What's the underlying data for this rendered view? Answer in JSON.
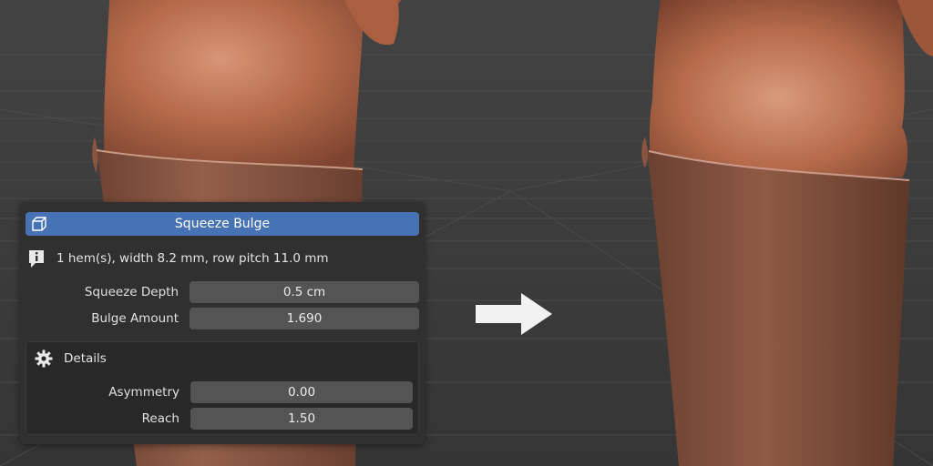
{
  "panel": {
    "title": "Squeeze Bulge",
    "header_icon": "cube-icon",
    "info_icon": "info-icon",
    "info_text": "1 hem(s), width 8.2 mm, row pitch 11.0 mm",
    "properties": [
      {
        "label": "Squeeze Depth",
        "value": "0.5 cm"
      },
      {
        "label": "Bulge Amount",
        "value": "1.690"
      }
    ],
    "details": {
      "title": "Details",
      "icon": "gear-icon",
      "properties": [
        {
          "label": "Asymmetry",
          "value": "0.00"
        },
        {
          "label": "Reach",
          "value": "1.50"
        }
      ]
    }
  },
  "colors": {
    "viewport_bg": "#3c3c3c",
    "panel_bg": "#303030",
    "header_bg": "#4772b3",
    "field_bg": "#545454",
    "skin": "#b86a48",
    "boot": "#8f5a43"
  }
}
